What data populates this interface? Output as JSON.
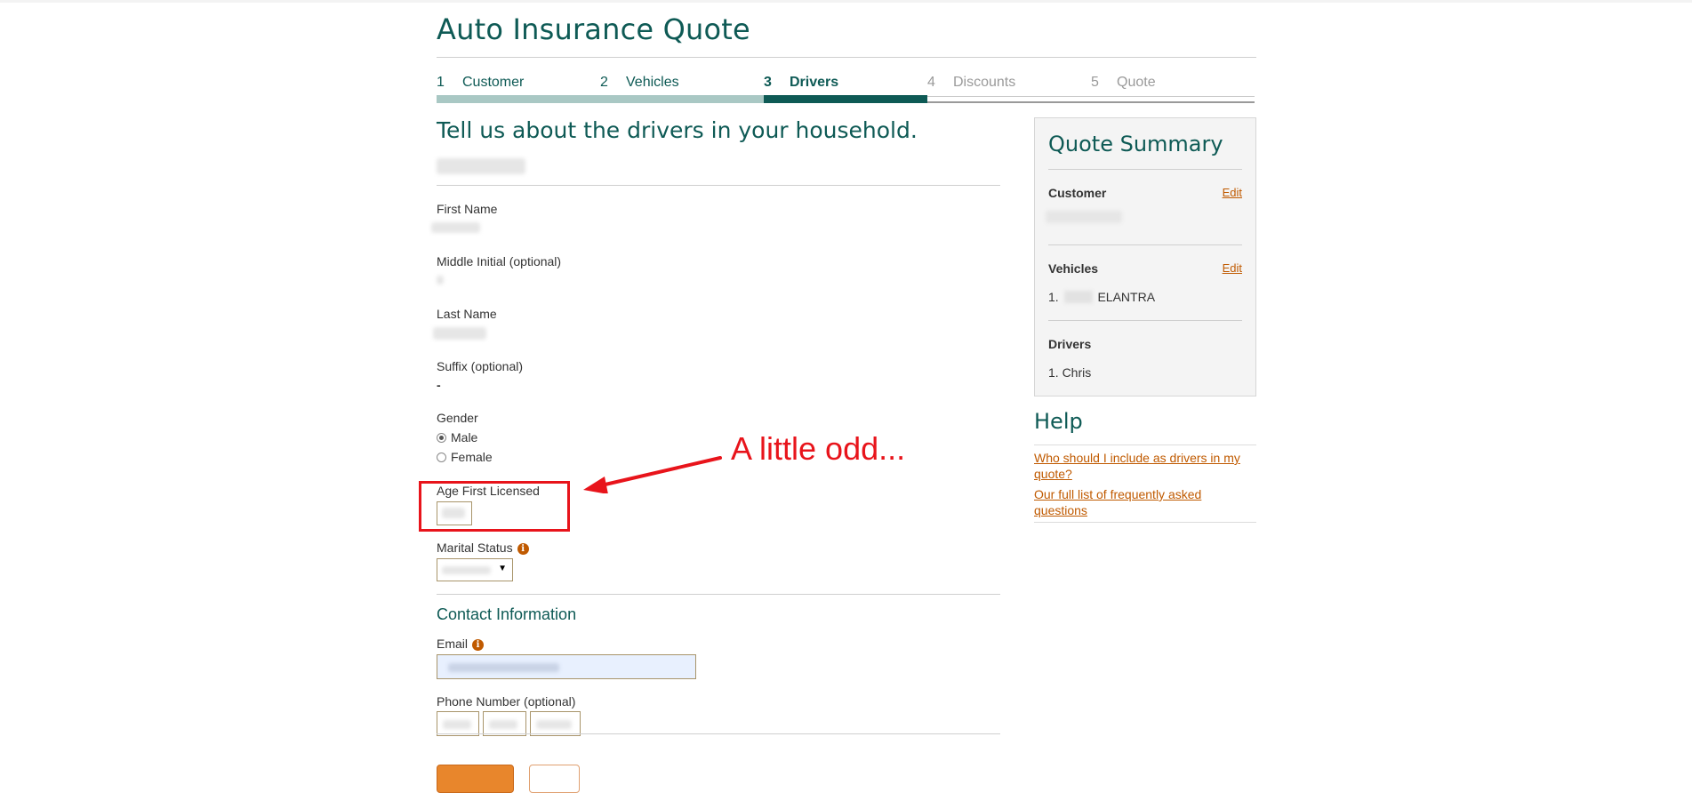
{
  "header": {
    "title": "Auto Insurance Quote"
  },
  "steps": [
    {
      "num": "1",
      "label": "Customer",
      "state": "done"
    },
    {
      "num": "2",
      "label": "Vehicles",
      "state": "done"
    },
    {
      "num": "3",
      "label": "Drivers",
      "state": "active"
    },
    {
      "num": "4",
      "label": "Discounts",
      "state": "future"
    },
    {
      "num": "5",
      "label": "Quote",
      "state": "future"
    }
  ],
  "form": {
    "heading": "Tell us about the drivers in your household.",
    "first_name_label": "First Name",
    "middle_initial_label": "Middle Initial (optional)",
    "last_name_label": "Last Name",
    "suffix_label": "Suffix (optional)",
    "suffix_value": "-",
    "gender_label": "Gender",
    "gender_options": [
      "Male",
      "Female"
    ],
    "gender_selected": "Male",
    "age_first_licensed_label": "Age First Licensed",
    "marital_status_label": "Marital Status",
    "select_arrow": "▼",
    "info_glyph": "i",
    "contact_heading": "Contact Information",
    "email_label": "Email",
    "phone_label": "Phone Number (optional)"
  },
  "summary": {
    "title": "Quote Summary",
    "customer_label": "Customer",
    "vehicles_label": "Vehicles",
    "drivers_label": "Drivers",
    "edit_label": "Edit",
    "vehicle_index": "1.",
    "vehicle_model": "ELANTRA",
    "driver_1": "1. Chris"
  },
  "help": {
    "title": "Help",
    "links": [
      "Who should I include as drivers in my quote?",
      "Our full list of frequently asked questions"
    ]
  },
  "annotation": {
    "text": "A little odd...",
    "color": "#e8141b"
  },
  "colors": {
    "brand": "#0e5a55",
    "accent": "#c05a00",
    "button": "#e8862c"
  }
}
